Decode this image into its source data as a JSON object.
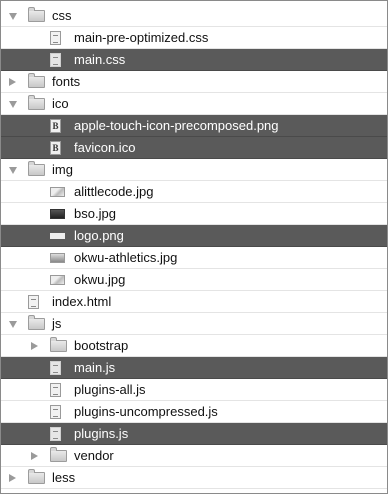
{
  "tree": [
    {
      "label": "css",
      "kind": "folder",
      "depth": 0,
      "expanded": true,
      "selected": false
    },
    {
      "label": "main-pre-optimized.css",
      "kind": "file",
      "depth": 1,
      "selected": false
    },
    {
      "label": "main.css",
      "kind": "file",
      "depth": 1,
      "selected": true
    },
    {
      "label": "fonts",
      "kind": "folder",
      "depth": 0,
      "expanded": false,
      "selected": false
    },
    {
      "label": "ico",
      "kind": "folder",
      "depth": 0,
      "expanded": true,
      "selected": false
    },
    {
      "label": "apple-touch-icon-precomposed.png",
      "kind": "png",
      "depth": 1,
      "selected": true
    },
    {
      "label": "favicon.ico",
      "kind": "png",
      "depth": 1,
      "selected": true
    },
    {
      "label": "img",
      "kind": "folder",
      "depth": 0,
      "expanded": true,
      "selected": false
    },
    {
      "label": "alittlecode.jpg",
      "kind": "img",
      "depth": 1,
      "selected": false
    },
    {
      "label": "bso.jpg",
      "kind": "img-dark",
      "depth": 1,
      "selected": false
    },
    {
      "label": "logo.png",
      "kind": "img-bar",
      "depth": 1,
      "selected": true
    },
    {
      "label": "okwu-athletics.jpg",
      "kind": "img-mid",
      "depth": 1,
      "selected": false
    },
    {
      "label": "okwu.jpg",
      "kind": "img",
      "depth": 1,
      "selected": false
    },
    {
      "label": "index.html",
      "kind": "file",
      "depth": 0,
      "selected": false
    },
    {
      "label": "js",
      "kind": "folder",
      "depth": 0,
      "expanded": true,
      "selected": false
    },
    {
      "label": "bootstrap",
      "kind": "folder",
      "depth": 1,
      "expanded": false,
      "selected": false
    },
    {
      "label": "main.js",
      "kind": "file",
      "depth": 1,
      "selected": true
    },
    {
      "label": "plugins-all.js",
      "kind": "file",
      "depth": 1,
      "selected": false
    },
    {
      "label": "plugins-uncompressed.js",
      "kind": "file",
      "depth": 1,
      "selected": false
    },
    {
      "label": "plugins.js",
      "kind": "file",
      "depth": 1,
      "selected": true
    },
    {
      "label": "vendor",
      "kind": "folder",
      "depth": 1,
      "expanded": false,
      "selected": false
    },
    {
      "label": "less",
      "kind": "folder",
      "depth": 0,
      "expanded": false,
      "selected": false
    }
  ],
  "icon_names": {
    "folder": "folder-icon",
    "file": "document-icon",
    "png": "png-file-icon",
    "img": "image-file-icon",
    "img-dark": "image-file-icon",
    "img-bar": "image-file-icon",
    "img-mid": "image-file-icon",
    "open": "disclosure-triangle-open-icon",
    "closed": "disclosure-triangle-closed-icon"
  },
  "colors": {
    "selection": "#5a5a5a",
    "triangle": "#9a9a9a",
    "row_divider": "#e4e4e4"
  }
}
